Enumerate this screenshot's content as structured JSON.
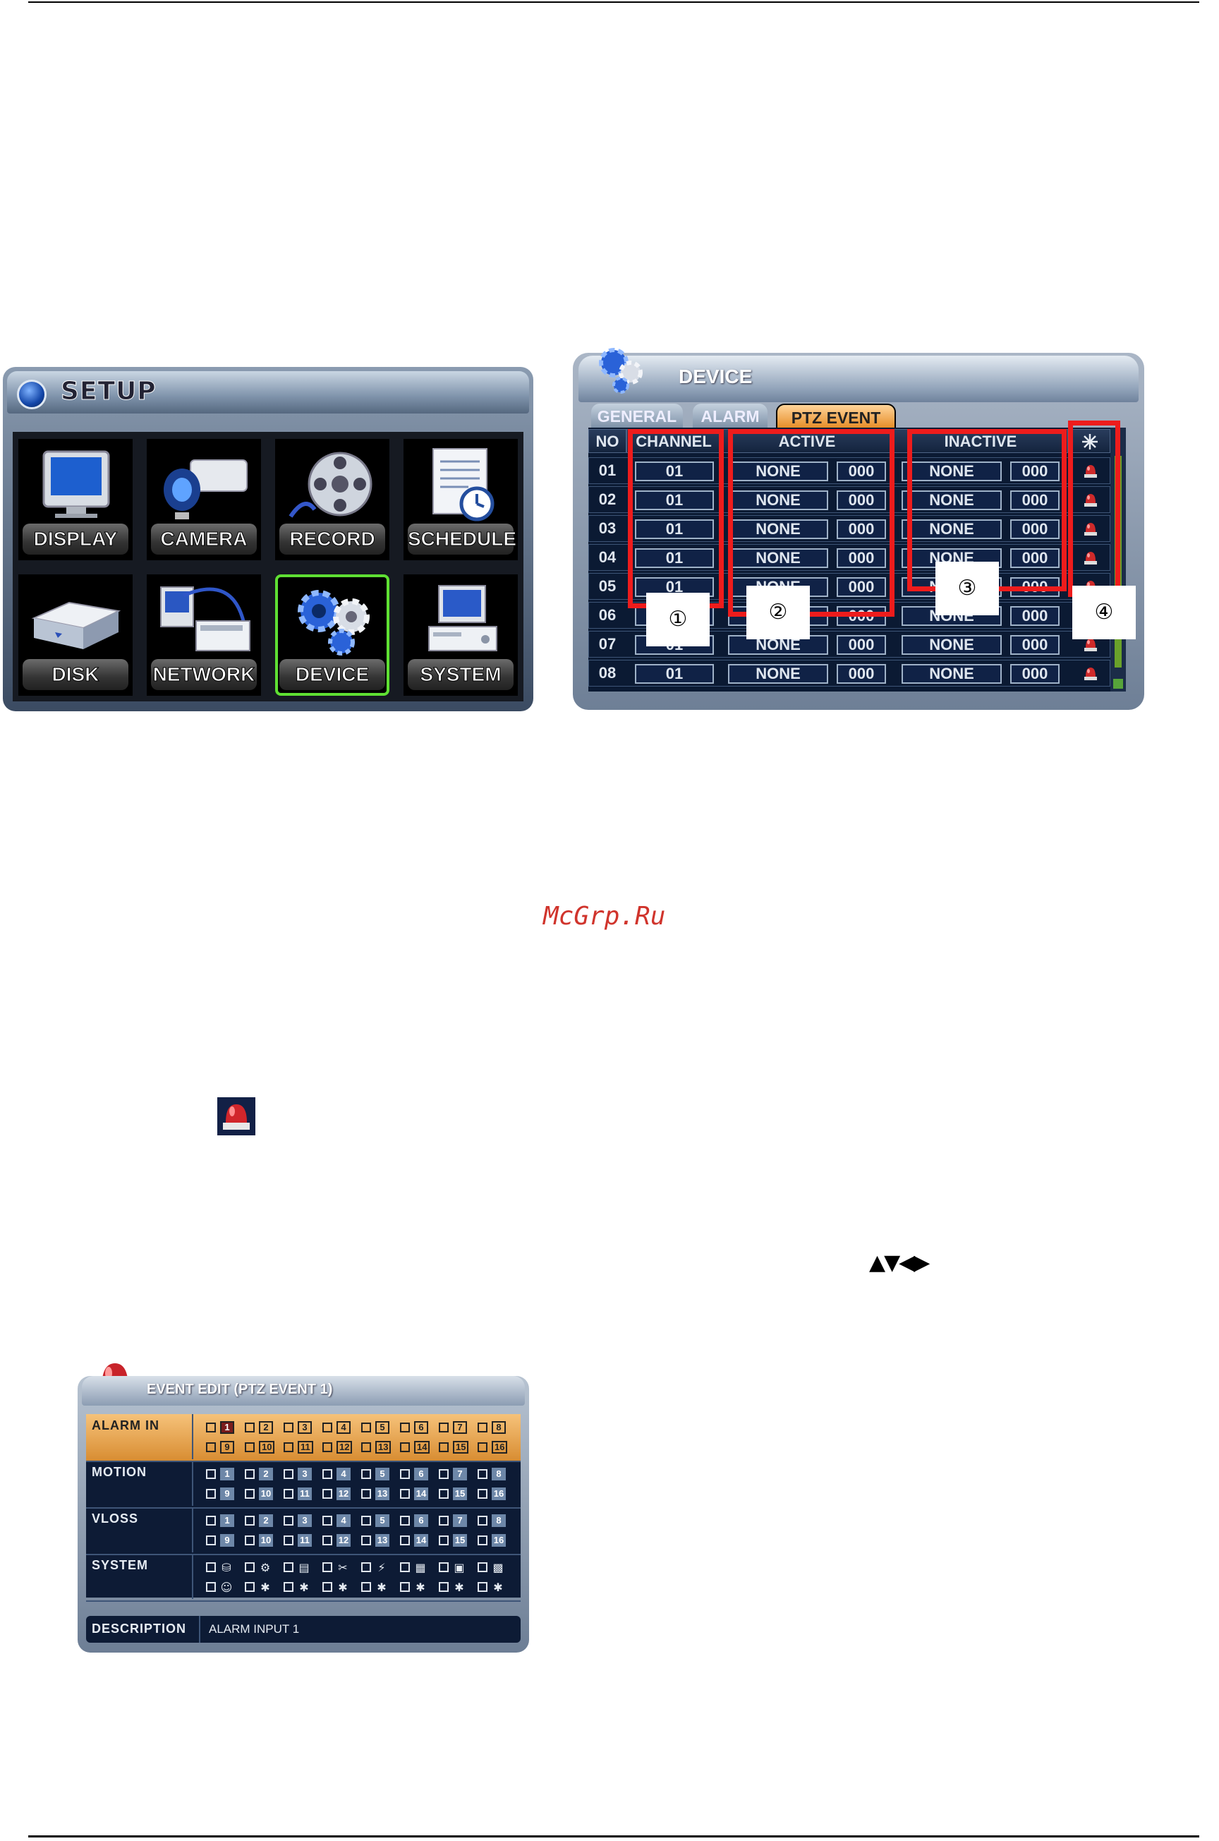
{
  "setup": {
    "title": "SETUP",
    "tiles": [
      {
        "label": "DISPLAY",
        "icon": "monitor-icon"
      },
      {
        "label": "CAMERA",
        "icon": "camera-icon"
      },
      {
        "label": "RECORD",
        "icon": "film-reel-icon"
      },
      {
        "label": "SCHEDULE",
        "icon": "schedule-clock-icon"
      },
      {
        "label": "DISK",
        "icon": "disk-drive-icon"
      },
      {
        "label": "NETWORK",
        "icon": "network-icon"
      },
      {
        "label": "DEVICE",
        "icon": "gears-icon",
        "selected": true
      },
      {
        "label": "SYSTEM",
        "icon": "computer-icon"
      }
    ]
  },
  "device": {
    "title": "DEVICE",
    "tabs": [
      "GENERAL",
      "ALARM",
      "PTZ EVENT"
    ],
    "active_tab": "PTZ EVENT",
    "columns": {
      "no": "NO",
      "channel": "CHANNEL",
      "active": "ACTIVE",
      "inactive": "INACTIVE"
    },
    "rows": [
      {
        "no": "01",
        "channel": "01",
        "active": "NONE",
        "active_preset": "000",
        "inactive": "NONE",
        "inactive_preset": "000"
      },
      {
        "no": "02",
        "channel": "01",
        "active": "NONE",
        "active_preset": "000",
        "inactive": "NONE",
        "inactive_preset": "000"
      },
      {
        "no": "03",
        "channel": "01",
        "active": "NONE",
        "active_preset": "000",
        "inactive": "NONE",
        "inactive_preset": "000"
      },
      {
        "no": "04",
        "channel": "01",
        "active": "NONE",
        "active_preset": "000",
        "inactive": "NONE",
        "inactive_preset": "000"
      },
      {
        "no": "05",
        "channel": "01",
        "active": "NONE",
        "active_preset": "000",
        "inactive": "NONE",
        "inactive_preset": "000"
      },
      {
        "no": "06",
        "channel": "01",
        "active": "NONE",
        "active_preset": "000",
        "inactive": "NONE",
        "inactive_preset": "000"
      },
      {
        "no": "07",
        "channel": "01",
        "active": "NONE",
        "active_preset": "000",
        "inactive": "NONE",
        "inactive_preset": "000"
      },
      {
        "no": "08",
        "channel": "01",
        "active": "NONE",
        "active_preset": "000",
        "inactive": "NONE",
        "inactive_preset": "000"
      }
    ],
    "callouts": [
      "①",
      "②",
      "③",
      "④"
    ],
    "accent_red": "#ee1c1c"
  },
  "watermark": "McGrp.Ru",
  "arrow_keys": "▲▼◀▶",
  "event_edit": {
    "title": "EVENT EDIT (PTZ EVENT 1)",
    "sections": [
      {
        "name": "ALARM IN",
        "numbers": [
          "1",
          "2",
          "3",
          "4",
          "5",
          "6",
          "7",
          "8",
          "9",
          "10",
          "11",
          "12",
          "13",
          "14",
          "15",
          "16"
        ]
      },
      {
        "name": "MOTION",
        "numbers": [
          "1",
          "2",
          "3",
          "4",
          "5",
          "6",
          "7",
          "8",
          "9",
          "10",
          "11",
          "12",
          "13",
          "14",
          "15",
          "16"
        ]
      },
      {
        "name": "VLOSS",
        "numbers": [
          "1",
          "2",
          "3",
          "4",
          "5",
          "6",
          "7",
          "8",
          "9",
          "10",
          "11",
          "12",
          "13",
          "14",
          "15",
          "16"
        ]
      },
      {
        "name": "SYSTEM"
      }
    ],
    "description_label": "DESCRIPTION",
    "description_value": "ALARM INPUT 1"
  }
}
